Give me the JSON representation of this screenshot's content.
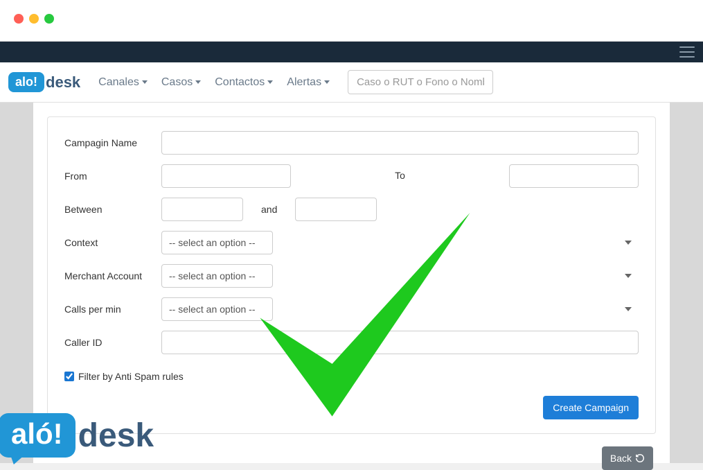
{
  "nav": {
    "links": [
      "Canales",
      "Casos",
      "Contactos",
      "Alertas"
    ],
    "search_placeholder": "Caso o RUT o Fono o Nombr"
  },
  "logo": {
    "bubble": "alo!",
    "text": "desk",
    "big_bubble": "aló!",
    "big_text": "desk"
  },
  "form": {
    "labels": {
      "campaign_name": "Campagin Name",
      "from": "From",
      "to": "To",
      "between": "Between",
      "and": "and",
      "context": "Context",
      "merchant_account": "Merchant Account",
      "calls_per_min": "Calls per min",
      "caller_id": "Caller ID"
    },
    "select_placeholder": "-- select an option --",
    "filter_spam": "Filter by Anti Spam rules",
    "filter_spam_checked": true,
    "create_button": "Create Campaign",
    "back_button": "Back"
  }
}
